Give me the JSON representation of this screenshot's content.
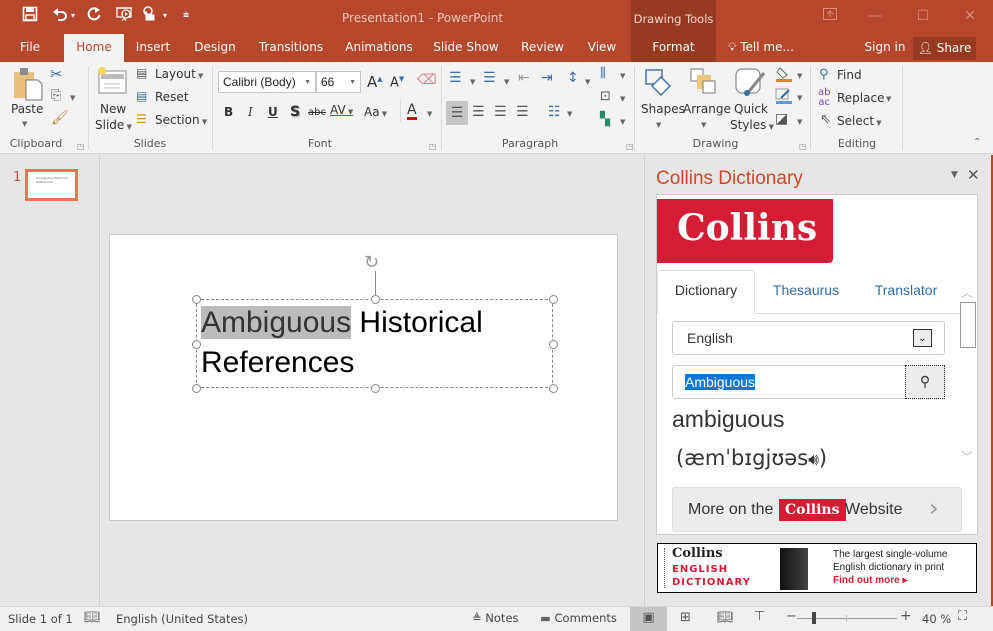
{
  "app": {
    "title": "Presentation1 - PowerPoint",
    "contextual_group": "Drawing Tools",
    "accent_color": "#b7472a",
    "collins_red": "#d41d35"
  },
  "quick_access": {
    "save": "save-icon",
    "undo": "undo-icon",
    "redo": "redo-icon",
    "present": "start-from-beginning-icon",
    "touch": "touch-mode-icon",
    "customize": "customize-qat-icon"
  },
  "window_controls": [
    "ribbon-display-options",
    "minimize",
    "maximize",
    "close"
  ],
  "tabs": [
    {
      "label": "File"
    },
    {
      "label": "Home",
      "active": true
    },
    {
      "label": "Insert"
    },
    {
      "label": "Design"
    },
    {
      "label": "Transitions"
    },
    {
      "label": "Animations"
    },
    {
      "label": "Slide Show"
    },
    {
      "label": "Review"
    },
    {
      "label": "View"
    },
    {
      "label": "Format"
    }
  ],
  "tell_me": "Tell me...",
  "sign_in": "Sign in",
  "share": "Share",
  "ribbon": {
    "clipboard": {
      "label": "Clipboard",
      "paste": "Paste"
    },
    "slides": {
      "label": "Slides",
      "new_slide_1": "New",
      "new_slide_2": "Slide",
      "layout": "Layout",
      "reset": "Reset",
      "section": "Section"
    },
    "font": {
      "label": "Font",
      "font_name": "Calibri (Body)",
      "font_size": "66",
      "bold": "B",
      "italic": "I",
      "underline": "U",
      "shadow": "S",
      "strike": "abc",
      "spacing": "AV",
      "case": "Aa",
      "color_letter": "A",
      "grow": "A",
      "shrink": "A"
    },
    "paragraph": {
      "label": "Paragraph"
    },
    "drawing": {
      "label": "Drawing",
      "shapes": "Shapes",
      "arrange": "Arrange",
      "quick_styles_1": "Quick",
      "quick_styles_2": "Styles"
    },
    "editing": {
      "label": "Editing",
      "find": "Find",
      "replace": "Replace",
      "select": "Select"
    }
  },
  "thumbnails": [
    {
      "number": "1",
      "text": "Ambiguous Historical References"
    }
  ],
  "slide": {
    "line1_selected": "Ambiguous",
    "line1_rest": " Historical",
    "line2": "References"
  },
  "taskpane": {
    "title": "Collins Dictionary",
    "logo": "Collins",
    "tabs": [
      {
        "label": "Dictionary",
        "active": true
      },
      {
        "label": "Thesaurus"
      },
      {
        "label": "Translator"
      }
    ],
    "language": "English",
    "search_value": "Ambiguous",
    "headword": "ambiguous",
    "pronunciation": "(æmˈbɪgjʊəs",
    "pronunciation_end": ")",
    "more_prefix": "More on the",
    "more_brand": "Collins",
    "more_suffix": "Website",
    "ad": {
      "brand": "Collins",
      "line1": "ENGLISH",
      "line2": "DICTIONARY",
      "tagline1": "The largest single-volume",
      "tagline2": "English dictionary in print",
      "cta": "Find out more ▸"
    }
  },
  "status": {
    "slide": "Slide 1 of 1",
    "language": "English (United States)",
    "notes": "Notes",
    "comments": "Comments",
    "zoom": "40 %",
    "zoom_level_percent": 40
  }
}
